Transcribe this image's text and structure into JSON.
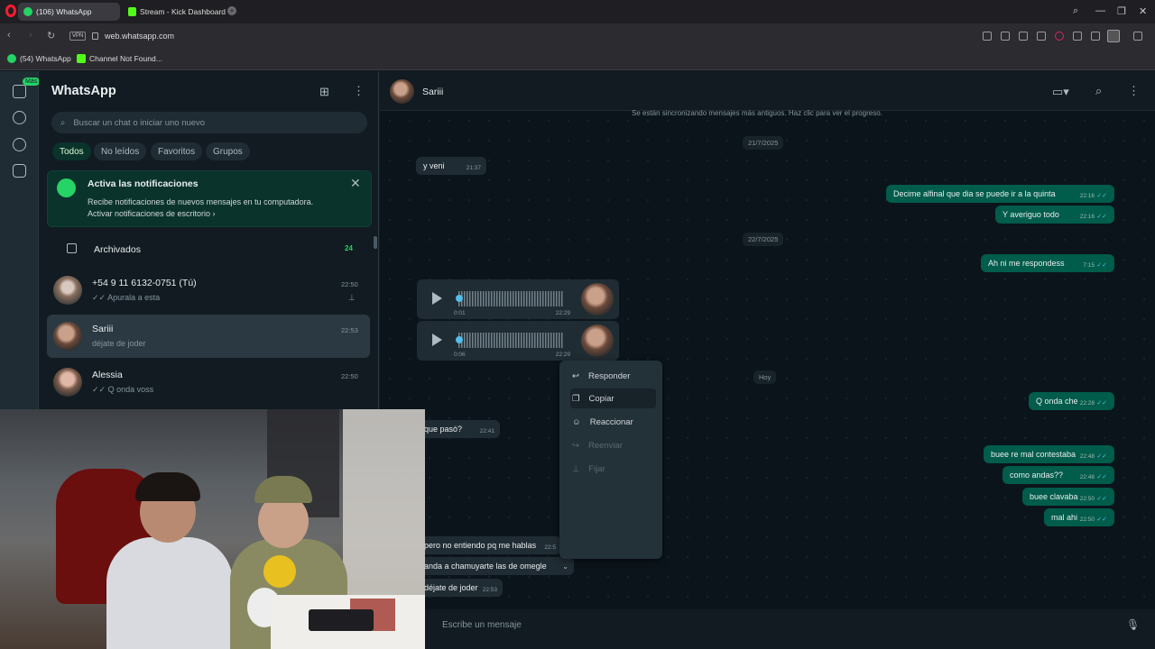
{
  "browser": {
    "tabs": [
      {
        "label": "(106) WhatsApp",
        "active": true
      },
      {
        "label": "Stream - Kick Dashboard",
        "active": false
      }
    ],
    "new_tab": "+",
    "vpn": "VPN",
    "url": "web.whatsapp.com",
    "bookmarks": [
      "(54) WhatsApp",
      "Channel Not Found..."
    ]
  },
  "app": {
    "title": "WhatsApp",
    "more_badge": "Más",
    "search_placeholder": "Buscar un chat o iniciar uno nuevo",
    "filters": [
      "Todos",
      "No leídos",
      "Favoritos",
      "Grupos"
    ],
    "active_filter": "Todos",
    "accent": "#25d366"
  },
  "notification_banner": {
    "title": "Activa las notificaciones",
    "body": "Recibe notificaciones de nuevos mensajes en tu computadora.",
    "link": "Activar notificaciones de escritorio ›",
    "close": "✕"
  },
  "archived": {
    "label": "Archivados",
    "count": "24"
  },
  "chats": [
    {
      "name": "+54 9 11 6132-0751 (Tú)",
      "preview": "✓✓ Apurala a esta",
      "time": "22:50",
      "pinned": true
    },
    {
      "name": "Sariii",
      "preview": "déjate de joder",
      "time": "22:53",
      "selected": true
    },
    {
      "name": "Alessia",
      "preview": "✓✓ Q onda voss",
      "time": "22:50"
    }
  ],
  "conversation": {
    "contact": "Sariii",
    "sync_notice": "Se están sincronizando mensajes más antiguos. Haz clic para ver el progreso.",
    "date1": "21/7/2025",
    "date2": "22/7/2025",
    "date3": "Hoy",
    "messages": [
      {
        "dir": "in",
        "text": "y veni",
        "time": "21:37"
      },
      {
        "dir": "out",
        "text": "Decime alfinal que dia se puede ir a la quinta",
        "time": "22:16"
      },
      {
        "dir": "out",
        "text": "Y averiguo todo",
        "time": "22:16"
      },
      {
        "dir": "out",
        "text": "Ah ni me respondess",
        "time": "7:15"
      },
      {
        "dir": "out",
        "text": "Q onda che",
        "time": "22:28"
      },
      {
        "dir": "in",
        "text": "que pasó?",
        "time": "22:41"
      },
      {
        "dir": "out",
        "text": "buee re mal contestaba",
        "time": "22:48"
      },
      {
        "dir": "out",
        "text": "como andas??",
        "time": "22:48"
      },
      {
        "dir": "out",
        "text": "buee clavaba",
        "time": "22:50"
      },
      {
        "dir": "out",
        "text": "mal ahi",
        "time": "22:50"
      },
      {
        "dir": "in",
        "text": "pero no entiendo pq me hablas",
        "time": "22:5"
      },
      {
        "dir": "in",
        "text": "anda a chamuyarte las de omegle",
        "time": ""
      },
      {
        "dir": "in",
        "text": "déjate de joder",
        "time": "22:53"
      }
    ],
    "voice_notes": [
      {
        "duration": "0:01",
        "time": "22:29"
      },
      {
        "duration": "0:06",
        "time": "22:29"
      }
    ],
    "read_tick": "✓✓",
    "input_placeholder": "Escribe un mensaje"
  },
  "context_menu": [
    {
      "label": "Responder",
      "icon": "reply-icon",
      "enabled": true
    },
    {
      "label": "Copiar",
      "icon": "copy-icon",
      "enabled": true,
      "highlighted": true
    },
    {
      "label": "Reaccionar",
      "icon": "emoji-icon",
      "enabled": true
    },
    {
      "label": "Reenviar",
      "icon": "forward-icon",
      "enabled": false
    },
    {
      "label": "Fijar",
      "icon": "pin-icon",
      "enabled": false
    }
  ]
}
